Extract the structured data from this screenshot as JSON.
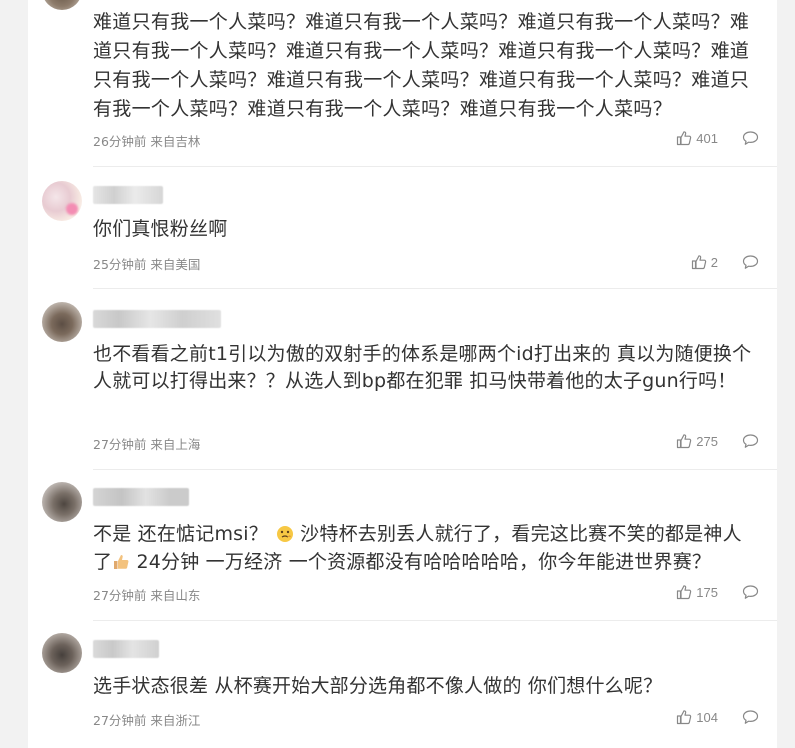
{
  "comments": [
    {
      "text": "难道只有我一个人菜吗？难道只有我一个人菜吗？难道只有我一个人菜吗？难道只有我一个人菜吗？难道只有我一个人菜吗？难道只有我一个人菜吗？难道只有我一个人菜吗？难道只有我一个人菜吗？难道只有我一个人菜吗？难道只有我一个人菜吗？难道只有我一个人菜吗？难道只有我一个人菜吗？",
      "meta": "26分钟前 来自吉林",
      "likes": "401"
    },
    {
      "text": "你们真恨粉丝啊",
      "meta": "25分钟前 来自美国",
      "likes": "2"
    },
    {
      "text": "也不看看之前t1引以为傲的双射手的体系是哪两个id打出来的 真以为随便换个人就可以打得出来？？从选人到bp都在犯罪 扣马快带着他的太子gun行吗！",
      "meta": "27分钟前 来自上海",
      "likes": "275"
    },
    {
      "text_part1": "不是 还在惦记msi？",
      "text_part2": " 沙特杯去别丢人就行了，看完这比赛不笑的都是神人了",
      "text_part3": " 24分钟 一万经济 一个资源都没有哈哈哈哈哈，你今年能进世界赛？",
      "meta": "27分钟前 来自山东",
      "likes": "175"
    },
    {
      "text": "选手状态很差 从杯赛开始大部分选角都不像人做的 你们想什么呢？",
      "meta": "27分钟前 来自浙江",
      "likes": "104"
    }
  ],
  "icons": {
    "like": "thumbs-up-icon",
    "reply": "comment-bubble-icon"
  },
  "colors": {
    "text": "#333333",
    "meta": "#888888",
    "background": "#f2f2f2"
  }
}
